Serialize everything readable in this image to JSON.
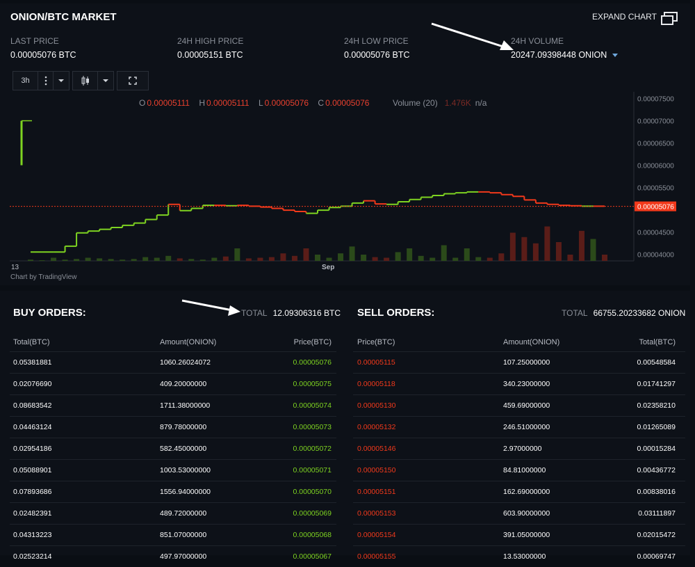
{
  "market": {
    "title": "ONION/BTC MARKET",
    "expand_label": "EXPAND CHART",
    "stats": [
      {
        "label": "LAST PRICE",
        "value": "0.00005076 BTC"
      },
      {
        "label": "24H HIGH PRICE",
        "value": "0.00005151 BTC"
      },
      {
        "label": "24H LOW PRICE",
        "value": "0.00005076 BTC"
      },
      {
        "label": "24H VOLUME",
        "value": "20247.09398448 ONION"
      }
    ],
    "toolbar": {
      "interval": "3h"
    }
  },
  "chart_data": {
    "type": "line",
    "ohlc": {
      "O": "0.00005111",
      "H": "0.00005111",
      "L": "0.00005076",
      "C": "0.00005076"
    },
    "ohlc_keys": {
      "o": "O",
      "h": "H",
      "l": "L",
      "c": "C"
    },
    "volume_label": "Volume (20)",
    "volume_value": "1.476K",
    "volume_na": "n/a",
    "y_ticks": [
      "0.00007500",
      "0.00007000",
      "0.00006500",
      "0.00006000",
      "0.00005500",
      "0.00004500",
      "0.00004000"
    ],
    "y_tick_values": [
      7.5e-05,
      7e-05,
      6.5e-05,
      6e-05,
      5.5e-05,
      4.5e-05,
      4e-05
    ],
    "current_price_label": "0.00005076",
    "current_price": 5.076e-05,
    "x_ticks": [
      "13",
      "Sep"
    ],
    "ylim": [
      3.85e-05,
      7.65e-05
    ],
    "price_series": [
      4.05e-05,
      4.05e-05,
      4.05e-05,
      4.18e-05,
      4.48e-05,
      4.52e-05,
      4.56e-05,
      4.6e-05,
      4.65e-05,
      4.7e-05,
      4.78e-05,
      4.88e-05,
      5.12e-05,
      4.98e-05,
      5.03e-05,
      5.1e-05,
      5.1e-05,
      5.09e-05,
      5.1e-05,
      5.08e-05,
      5.06e-05,
      5.03e-05,
      4.99e-05,
      4.96e-05,
      4.92e-05,
      4.99e-05,
      5.05e-05,
      5.08e-05,
      5.15e-05,
      5.2e-05,
      5.13e-05,
      5.12e-05,
      5.18e-05,
      5.23e-05,
      5.28e-05,
      5.32e-05,
      5.36e-05,
      5.38e-05,
      5.4e-05,
      5.4e-05,
      5.38e-05,
      5.34e-05,
      5.3e-05,
      5.22e-05,
      5.15e-05,
      5.12e-05,
      5.1e-05,
      5.09e-05,
      5.08e-05,
      5.08e-05,
      5.07e-05
    ],
    "volume_series": [
      0.02,
      0.01,
      0.05,
      0.02,
      0.03,
      0.05,
      0.04,
      0.03,
      0.02,
      0.03,
      0.06,
      0.05,
      0.08,
      0.04,
      0.03,
      0.02,
      0.05,
      0.07,
      0.2,
      0.04,
      0.05,
      0.06,
      0.12,
      0.08,
      0.2,
      0.1,
      0.05,
      0.12,
      0.23,
      0.1,
      0.06,
      0.05,
      0.14,
      0.2,
      0.08,
      0.05,
      0.25,
      0.05,
      0.2,
      0.06,
      0.05,
      0.12,
      0.45,
      0.38,
      0.28,
      0.55,
      0.3,
      0.1,
      0.48,
      0.35,
      0.1
    ],
    "early_spike": {
      "low": 6e-05,
      "high": 7e-05
    }
  },
  "buy": {
    "title": "BUY ORDERS:",
    "total_label": "TOTAL",
    "total_value": "12.09306316 BTC",
    "headers": [
      "Total(BTC)",
      "Amount(ONION)",
      "Price(BTC)"
    ],
    "rows": [
      [
        "0.05381881",
        "1060.26024072",
        "0.00005076"
      ],
      [
        "0.02076690",
        "409.20000000",
        "0.00005075"
      ],
      [
        "0.08683542",
        "1711.38000000",
        "0.00005074"
      ],
      [
        "0.04463124",
        "879.78000000",
        "0.00005073"
      ],
      [
        "0.02954186",
        "582.45000000",
        "0.00005072"
      ],
      [
        "0.05088901",
        "1003.53000000",
        "0.00005071"
      ],
      [
        "0.07893686",
        "1556.94000000",
        "0.00005070"
      ],
      [
        "0.02482391",
        "489.72000000",
        "0.00005069"
      ],
      [
        "0.04313223",
        "851.07000000",
        "0.00005068"
      ],
      [
        "0.02523214",
        "497.97000000",
        "0.00005067"
      ]
    ]
  },
  "sell": {
    "title": "SELL ORDERS:",
    "total_label": "TOTAL",
    "total_value": "66755.20233682 ONION",
    "headers": [
      "Price(BTC)",
      "Amount(ONION)",
      "Total(BTC)"
    ],
    "rows": [
      [
        "0.00005115",
        "107.25000000",
        "0.00548584"
      ],
      [
        "0.00005118",
        "340.23000000",
        "0.01741297"
      ],
      [
        "0.00005130",
        "459.69000000",
        "0.02358210"
      ],
      [
        "0.00005132",
        "246.51000000",
        "0.01265089"
      ],
      [
        "0.00005146",
        "2.97000000",
        "0.00015284"
      ],
      [
        "0.00005150",
        "84.81000000",
        "0.00436772"
      ],
      [
        "0.00005151",
        "162.69000000",
        "0.00838016"
      ],
      [
        "0.00005153",
        "603.90000000",
        "0.03111897"
      ],
      [
        "0.00005154",
        "391.05000000",
        "0.02015472"
      ],
      [
        "0.00005155",
        "13.53000000",
        "0.00069747"
      ]
    ]
  },
  "colors": {
    "buy": "#7ed321",
    "sell": "#f2391b",
    "background": "#0d1118"
  },
  "footer": {
    "attribution": "Chart by TradingView"
  }
}
